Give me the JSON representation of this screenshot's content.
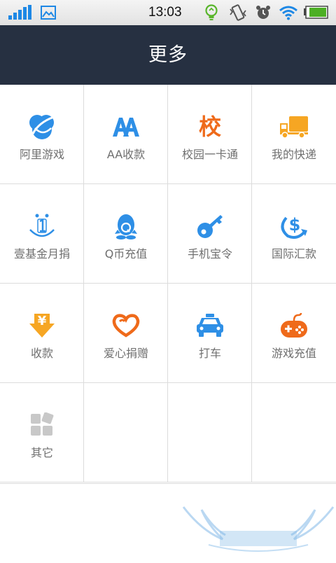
{
  "status_bar": {
    "time": "13:03"
  },
  "header": {
    "title": "更多"
  },
  "grid": {
    "items": [
      {
        "label": "阿里游戏",
        "icon": "ali-game-icon"
      },
      {
        "label": "AA收款",
        "icon": "aa-collect-icon"
      },
      {
        "label": "校园一卡通",
        "icon": "campus-card-icon",
        "glyph": "校"
      },
      {
        "label": "我的快递",
        "icon": "delivery-truck-icon"
      },
      {
        "label": "壹基金月捐",
        "icon": "one-foundation-icon"
      },
      {
        "label": "Q币充值",
        "icon": "qq-coin-icon"
      },
      {
        "label": "手机宝令",
        "icon": "key-icon"
      },
      {
        "label": "国际汇款",
        "icon": "international-remit-icon"
      },
      {
        "label": "收款",
        "icon": "receive-money-icon",
        "glyph": "¥"
      },
      {
        "label": "爱心捐赠",
        "icon": "heart-donate-icon"
      },
      {
        "label": "打车",
        "icon": "taxi-icon"
      },
      {
        "label": "游戏充值",
        "icon": "gamepad-icon"
      },
      {
        "label": "其它",
        "icon": "more-apps-icon"
      }
    ]
  },
  "colors": {
    "header_bg": "#263041",
    "blue": "#2e8fe6",
    "orange": "#ef6a1a",
    "yellow": "#f6a623"
  }
}
